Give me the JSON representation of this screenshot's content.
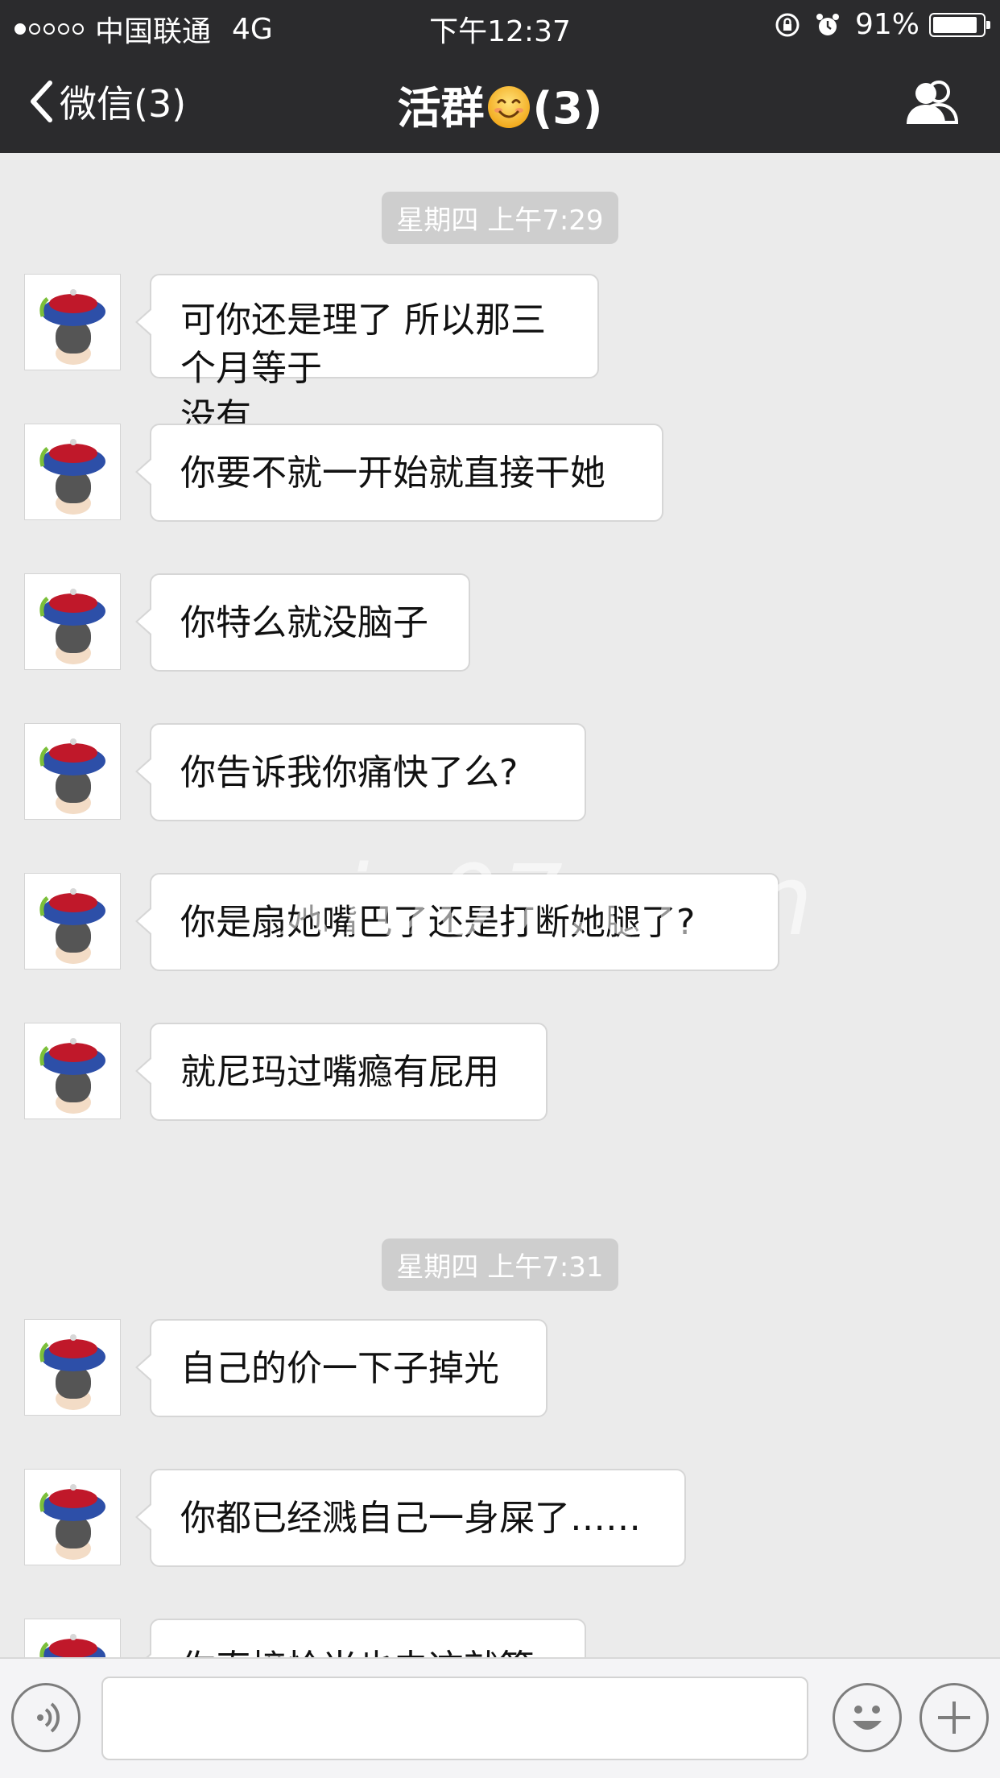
{
  "status_bar": {
    "carrier": "中国联通",
    "network": "4G",
    "time": "下午12:37",
    "battery": "91%",
    "battery_level": 0.91,
    "signal_bars_filled": 1,
    "signal_bars_total": 5
  },
  "nav": {
    "back_label": "微信(3)",
    "title_prefix": "活群",
    "title_suffix": "(3)",
    "icons": [
      "chevron-left-icon",
      "smiley-emoji-icon",
      "group-members-icon"
    ]
  },
  "chat": {
    "timestamps": [
      "星期四 上午7:29",
      "星期四 上午7:31"
    ],
    "messages": [
      {
        "text_lines": [
          "可你还是理了 所以那三个月等于",
          "没有"
        ]
      },
      {
        "text_lines": [
          "你要不就一开始就直接干她"
        ]
      },
      {
        "text_lines": [
          "你特么就没脑子"
        ]
      },
      {
        "text_lines": [
          "你告诉我你痛快了么?"
        ]
      },
      {
        "text_lines": [
          "你是扇她嘴巴了还是打断她腿了?"
        ]
      },
      {
        "text_lines": [
          "就尼玛过嘴瘾有屁用"
        ]
      },
      {
        "text_lines": [
          "自己的价一下子掉光"
        ]
      },
      {
        "text_lines": [
          "你都已经溅自己一身屎了……"
        ]
      },
      {
        "text_lines": [
          "你直接恰当也去这就算了"
        ]
      }
    ],
    "watermark": "xiu07.com"
  },
  "input_bar": {
    "icons": [
      "voice-icon",
      "emoji-icon",
      "plus-icon"
    ],
    "value": ""
  },
  "colors": {
    "bar_bg": "#2b2b2d",
    "chat_bg": "#ebebeb",
    "bubble_bg": "#ffffff",
    "timestamp_bg": "#cecece"
  }
}
